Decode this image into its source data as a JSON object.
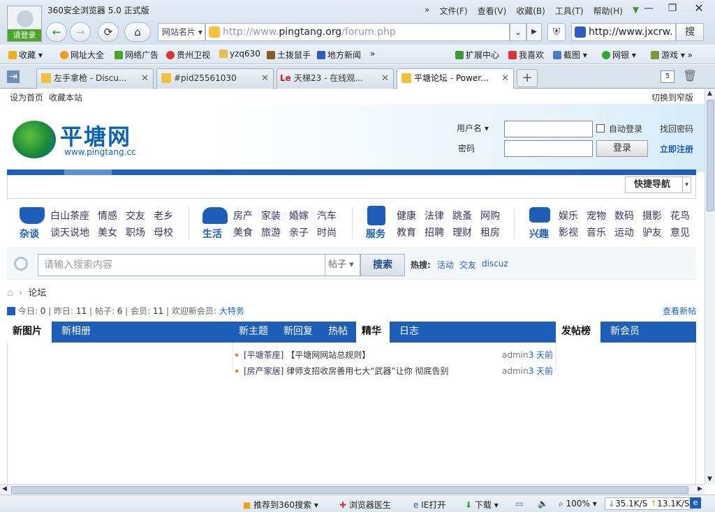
{
  "browser": {
    "title": "360安全浏览器 5.0 正式版",
    "login_badge": "请登录",
    "menu": [
      "文件(F)",
      "查看(V)",
      "收藏(B)",
      "工具(T)",
      "帮助(H)"
    ],
    "site_card": "网站名片",
    "url": {
      "prefix": "http://www.",
      "domain": "pingtang.org",
      "path": "/forum.php"
    },
    "search_value": "http://www.jxcrw.",
    "search_button": "搜"
  },
  "favorites": [
    "收藏",
    "网址大全",
    "网络广告",
    "贵州卫视",
    "yzq630",
    "土拨鼠手",
    "地方新闻"
  ],
  "favorites_right": [
    "扩展中心",
    "我喜欢",
    "截图",
    "网银",
    "游戏"
  ],
  "tabs": [
    {
      "label": "左手拿枪 - Discu..."
    },
    {
      "label": "#pid25561030"
    },
    {
      "label": "天梯23 - 在线观..."
    },
    {
      "label": "平塘论坛 - Power..."
    }
  ],
  "tab_count": "5",
  "page": {
    "topbar": {
      "set_home": "设为首页",
      "bookmark": "收藏本站",
      "switch_width": "切换到窄版"
    },
    "logo": {
      "name": "平塘网",
      "url": "www.pingtang.cc"
    },
    "login": {
      "username_label": "用户名",
      "password_label": "密码",
      "auto_login": "自动登录",
      "forgot": "找回密码",
      "login_btn": "登录",
      "register": "立即注册"
    },
    "quick_nav": "快捷导航",
    "categories": [
      {
        "name": "杂谈",
        "links": [
          "白山茶座",
          "情感",
          "交友",
          "老乡",
          "谈天说地",
          "美女",
          "职场",
          "母校"
        ]
      },
      {
        "name": "生活",
        "links": [
          "房产",
          "家装",
          "婚嫁",
          "汽车",
          "美食",
          "旅游",
          "亲子",
          "时尚"
        ]
      },
      {
        "name": "服务",
        "links": [
          "健康",
          "法律",
          "跳蚤",
          "网购",
          "教育",
          "招聘",
          "理财",
          "租房"
        ]
      },
      {
        "name": "兴趣",
        "links": [
          "娱乐",
          "宠物",
          "数码",
          "摄影",
          "花鸟",
          "影视",
          "音乐",
          "运动",
          "驴友",
          "意见"
        ]
      }
    ],
    "search": {
      "placeholder": "请输入搜索内容",
      "type": "帖子",
      "button": "搜索",
      "hot_label": "热搜:",
      "hot": [
        "活动",
        "交友",
        "discuz"
      ]
    },
    "breadcrumb": "论坛",
    "stats": {
      "today_label": "今日:",
      "today": "0",
      "yesterday_label": "昨日:",
      "yesterday": "11",
      "posts_label": "帖子:",
      "posts": "6",
      "members_label": "会员:",
      "members": "11",
      "welcome_label": "欢迎新会员:",
      "new_member": "大特务",
      "view_new": "查看新帖"
    },
    "box_tabs_left": [
      "新图片",
      "新相册"
    ],
    "box_tabs_mid": [
      "新主题",
      "新回复",
      "热帖",
      "精华",
      "日志"
    ],
    "box_tabs_right": [
      "发帖榜",
      "新会员"
    ],
    "posts": [
      {
        "cat": "[平塘茶座]",
        "title": "【平塘网网站总规则】",
        "author": "admin",
        "time": "3 天前"
      },
      {
        "cat": "[房产家居]",
        "title": "律师支招收房善用七大“武器”让你 彻底告别",
        "author": "admin",
        "time": "3 天前"
      }
    ]
  },
  "status": {
    "recommend": "推荐到360搜索",
    "doctor": "浏览器医生",
    "ie": "IE打开",
    "download": "下载",
    "zoom": "100%",
    "down_speed": "35.1K/S",
    "up_speed": "13.1K/S"
  }
}
